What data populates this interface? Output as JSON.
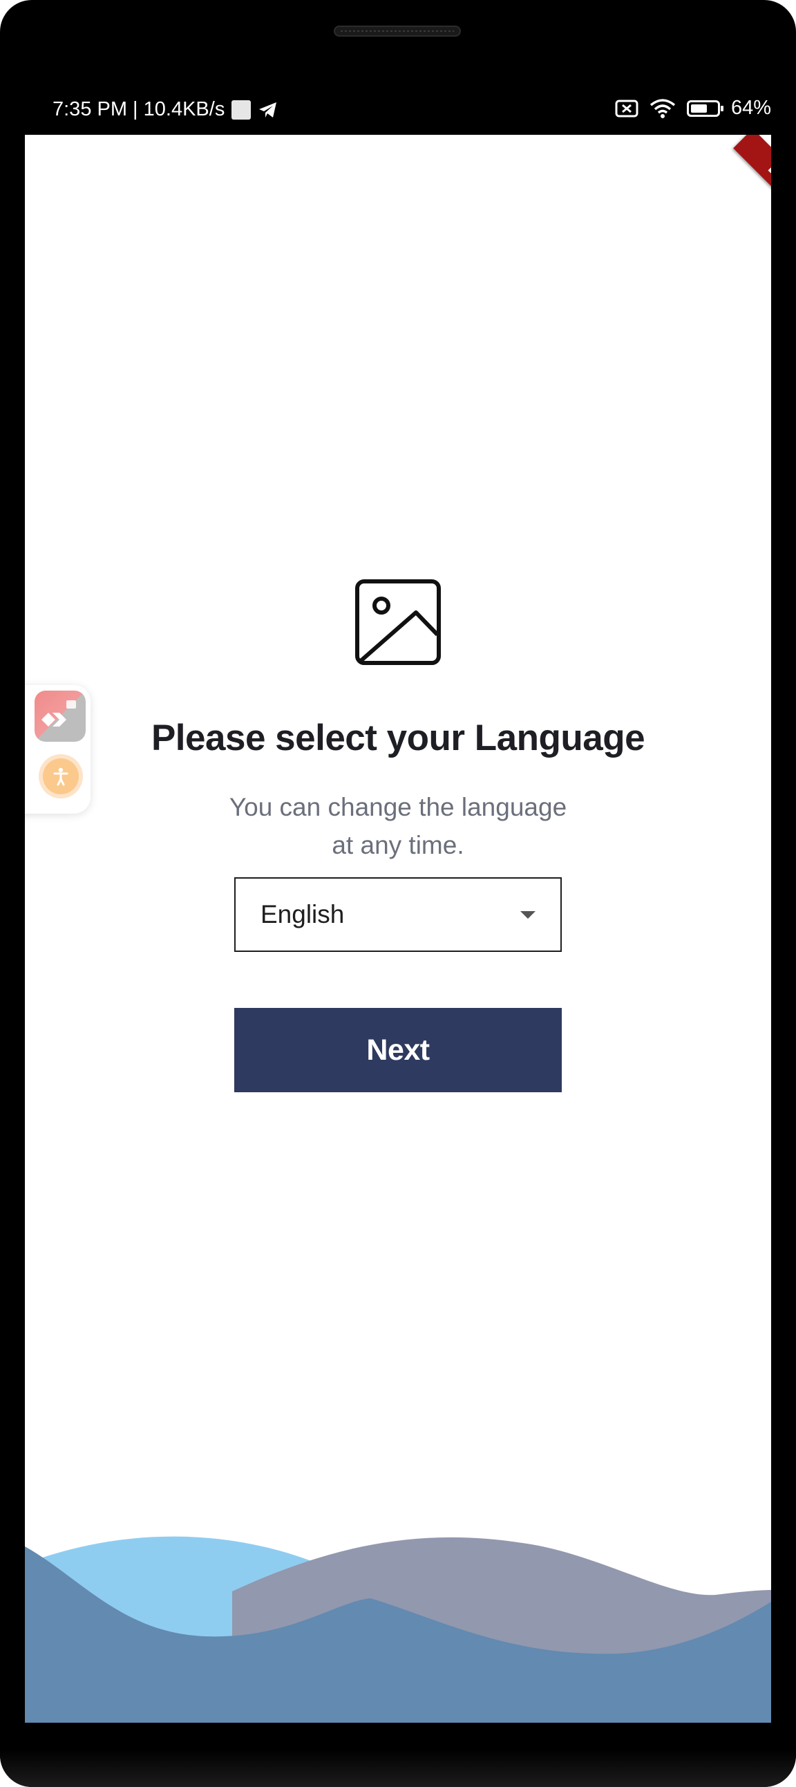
{
  "status_bar": {
    "time_speed": "7:35 PM | 10.4KB/s",
    "battery_text": "64%",
    "battery_level": 0.64,
    "icons": [
      "image-square-icon",
      "telegram-icon",
      "sim-error-icon",
      "wifi-icon",
      "battery-icon"
    ]
  },
  "debug_banner": "DEBUG",
  "language_screen": {
    "title": "Please select your Language",
    "subtitle": "You can change the language at any time.",
    "dropdown_value": "English",
    "next_label": "Next"
  },
  "floating_panel": {
    "icons": [
      "anydesk-icon",
      "accessibility-icon"
    ]
  },
  "colors": {
    "primary": "#2e3a5f",
    "wave_light": "#8fcdf0",
    "wave_gray": "#9298ae",
    "wave_dark": "#638ab0",
    "debug": "#a31515"
  }
}
